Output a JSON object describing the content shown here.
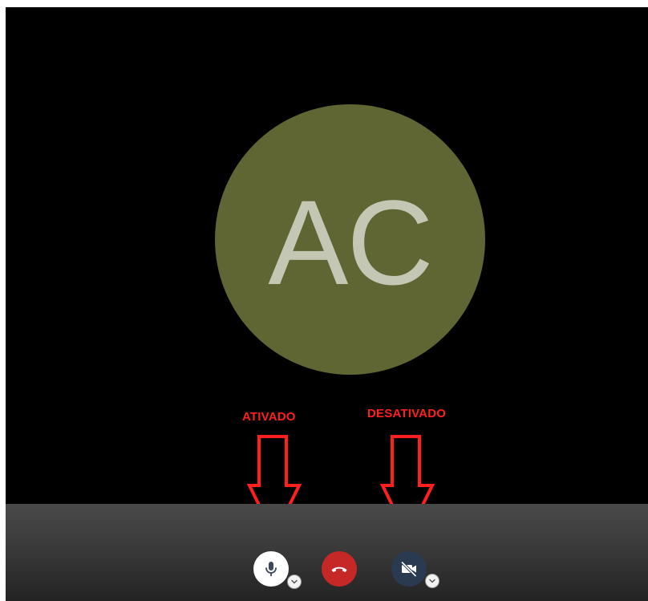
{
  "call": {
    "avatar_initials": "AC",
    "avatar_color": "#5f6633"
  },
  "annotations": {
    "mic_state_label": "ATIVADO",
    "camera_state_label": "DESATIVADO",
    "annotation_color": "#ff1f1f"
  },
  "controls": {
    "mic": {
      "icon": "microphone-icon",
      "state": "on"
    },
    "hangup": {
      "icon": "phone-hangup-icon",
      "color": "#c62828"
    },
    "camera": {
      "icon": "video-off-icon",
      "state": "off"
    }
  }
}
